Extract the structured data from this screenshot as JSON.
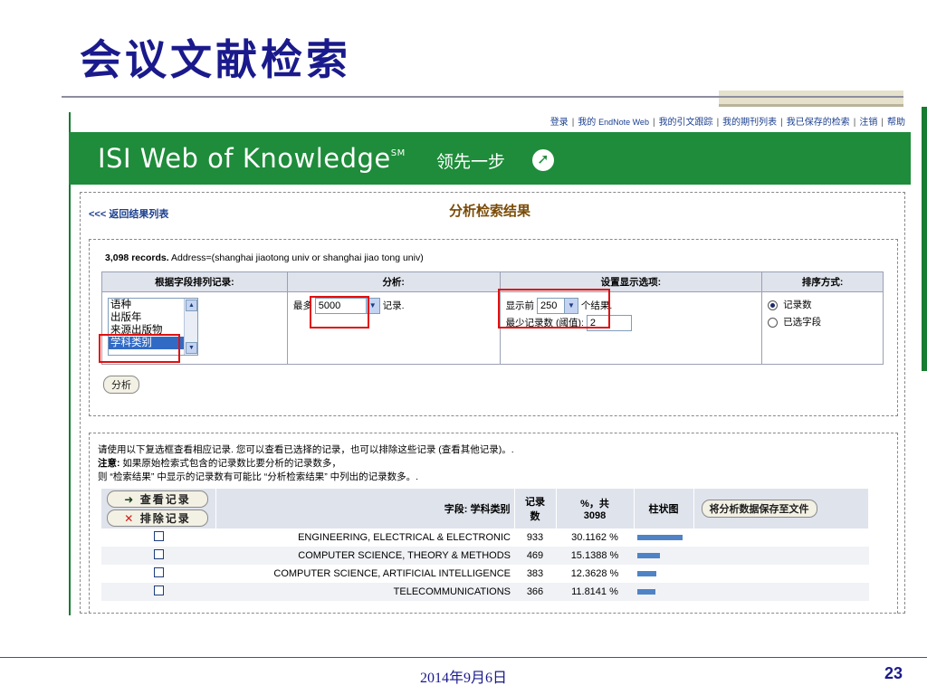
{
  "slide": {
    "title": "会议文献检索",
    "footer_date": "2014年9月6日",
    "page_number": "23"
  },
  "top_links": {
    "login": "登录",
    "my": "我的",
    "endnote": "EndNote Web",
    "citation_tracker": "我的引文跟踪",
    "journal_list": "我的期刊列表",
    "saved_searches": "我已保存的检索",
    "logout": "注销",
    "help": "帮助",
    "separator": "|"
  },
  "banner": {
    "brand": "ISI Web of Knowledge",
    "trademark": "SM",
    "slogan": "领先一步",
    "slogan_icon": "arrow-circle-icon"
  },
  "page": {
    "back_link": "<<< 返回结果列表",
    "heading": "分析检索结果",
    "records_count": "3,098 records.",
    "records_query": " Address=(shanghai jiaotong univ or shanghai jiao tong univ)"
  },
  "analysis_table": {
    "headers": [
      "根据字段排列记录:",
      "分析:",
      "设置显示选项:",
      "排序方式:"
    ],
    "field_list": [
      "语种",
      "出版年",
      "来源出版物",
      "学科类别"
    ],
    "selected_field": "学科类别",
    "analyze_prefix": "最多",
    "analyze_value": "5000",
    "analyze_suffix": "记录.",
    "display_prefix": "显示前",
    "display_value": "250",
    "display_suffix": "个结果.",
    "min_records_label": "最少记录数 (阈值):",
    "min_records_value": "2",
    "sort_options": [
      "记录数",
      "已选字段"
    ],
    "sort_selected": "记录数",
    "analyze_button": "分析"
  },
  "instructions": {
    "line1": "请使用以下复选框查看相应记录. 您可以查看已选择的记录，也可以排除这些记录 (查看其他记录)。.",
    "note_label": "注意:",
    "line2": " 如果原始检索式包含的记录数比要分析的记录数多，",
    "line3": "则 “检索结果” 中显示的记录数有可能比 “分析检索结果” 中列出的记录数多。."
  },
  "results_table": {
    "view_button": "查看记录",
    "exclude_button": "排除记录",
    "col_field": "字段: 学科类别",
    "col_count_line1": "记录",
    "col_count_line2": "数",
    "col_pct_line1": "%，共",
    "col_pct_line2": "3098",
    "col_bar": "柱状图",
    "save_button": "将分析数据保存至文件"
  },
  "chart_data": {
    "type": "bar",
    "categories": [
      "ENGINEERING, ELECTRICAL & ELECTRONIC",
      "COMPUTER SCIENCE, THEORY & METHODS",
      "COMPUTER SCIENCE, ARTIFICIAL INTELLIGENCE",
      "TELECOMMUNICATIONS"
    ],
    "values": [
      933,
      469,
      383,
      366
    ],
    "percentages": [
      "30.1162 %",
      "15.1388 %",
      "12.3628 %",
      "11.8141 %"
    ],
    "total": 3098,
    "bar_color": "#4f83c6"
  },
  "colors": {
    "title": "#1a1a8c",
    "banner_green": "#1e8c3a",
    "highlight_red": "#e01010",
    "heading_brown": "#7a4b06"
  }
}
